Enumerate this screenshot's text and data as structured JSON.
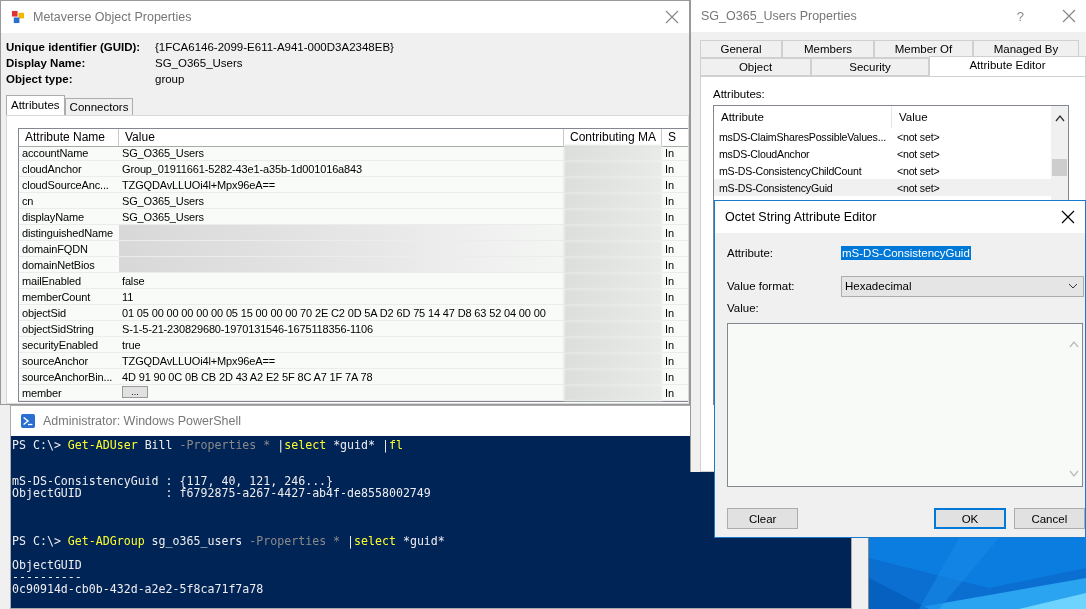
{
  "metaverse_window": {
    "title": "Metaverse Object Properties",
    "fields": [
      {
        "label": "Unique identifier (GUID):",
        "value": "{1FCA6146-2099-E611-A941-000D3A2348EB}"
      },
      {
        "label": "Display Name:",
        "value": "SG_O365_Users"
      },
      {
        "label": "Object type:",
        "value": "group"
      }
    ],
    "tabs": [
      {
        "label": "Attributes",
        "selected": true
      },
      {
        "label": "Connectors",
        "selected": false
      }
    ],
    "table": {
      "columns": [
        "Attribute Name",
        "Value",
        "Contributing MA",
        "S"
      ],
      "rows": [
        {
          "name": "accountName",
          "kind": "text",
          "value": "SG_O365_Users",
          "column_4": "In"
        },
        {
          "name": "cloudAnchor",
          "kind": "text",
          "value": "Group_01911661-5282-43e1-a35b-1d001016a843",
          "column_4": "In"
        },
        {
          "name": "cloudSourceAnc...",
          "kind": "text",
          "value": "TZGQDAvLLUOi4l+Mpx96eA==",
          "column_4": "In"
        },
        {
          "name": "cn",
          "kind": "text",
          "value": "SG_O365_Users",
          "column_4": "In"
        },
        {
          "name": "displayName",
          "kind": "text",
          "value": "SG_O365_Users",
          "column_4": "In"
        },
        {
          "name": "distinguishedName",
          "kind": "redacted",
          "column_4": "In"
        },
        {
          "name": "domainFQDN",
          "kind": "redacted",
          "column_4": "In"
        },
        {
          "name": "domainNetBios",
          "kind": "redacted",
          "column_4": "In"
        },
        {
          "name": "mailEnabled",
          "kind": "text",
          "value": "false",
          "column_4": "In"
        },
        {
          "name": "memberCount",
          "kind": "text",
          "value": "11",
          "column_4": "In"
        },
        {
          "name": "objectSid",
          "kind": "text",
          "value": "01 05 00 00 00 00 00 05 15 00 00 00 70 2E C2 0D 5A D2 6D 75 14 47 D8 63 52 04 00 00",
          "column_4": "In"
        },
        {
          "name": "objectSidString",
          "kind": "text",
          "value": "S-1-5-21-230829680-1970131546-1675118356-1106",
          "column_4": "In"
        },
        {
          "name": "securityEnabled",
          "kind": "text",
          "value": "true",
          "column_4": "In"
        },
        {
          "name": "sourceAnchor",
          "kind": "text",
          "value": "TZGQDAvLLUOi4l+Mpx96eA==",
          "column_4": "In"
        },
        {
          "name": "sourceAnchorBin...",
          "kind": "text",
          "value": "4D 91 90 0C 0B CB 2D 43 A2 E2 5F 8C A7 1F 7A 78",
          "column_4": "In"
        },
        {
          "name": "member",
          "kind": "button",
          "value": "...",
          "column_4": "In"
        }
      ]
    }
  },
  "powershell_window": {
    "title": "Administrator: Windows PowerShell",
    "lines": [
      {
        "kind": "line",
        "segments": [
          {
            "kind": "plain",
            "text": "PS C:\\> "
          },
          {
            "kind": "cmd",
            "text": "Get-ADUser"
          },
          {
            "kind": "plain",
            "text": " Bill "
          },
          {
            "kind": "param",
            "text": "-Properties * "
          },
          {
            "kind": "plain",
            "text": "|"
          },
          {
            "kind": "cmd",
            "text": "select"
          },
          {
            "kind": "plain",
            "text": " *guid* |"
          },
          {
            "kind": "cmd",
            "text": "fl"
          }
        ]
      },
      {
        "kind": "blank"
      },
      {
        "kind": "blank"
      },
      {
        "kind": "line",
        "segments": [
          {
            "kind": "plain",
            "text": "mS-DS-ConsistencyGuid : {117, 40, 121, 246...}"
          }
        ]
      },
      {
        "kind": "line",
        "segments": [
          {
            "kind": "plain",
            "text": "ObjectGUID            : f6792875-a267-4427-ab4f-de8558002749"
          }
        ]
      },
      {
        "kind": "blank"
      },
      {
        "kind": "blank"
      },
      {
        "kind": "blank"
      },
      {
        "kind": "line",
        "segments": [
          {
            "kind": "plain",
            "text": "PS C:\\> "
          },
          {
            "kind": "cmd",
            "text": "Get-ADGroup"
          },
          {
            "kind": "plain",
            "text": " sg_o365_users "
          },
          {
            "kind": "param",
            "text": "-Properties * "
          },
          {
            "kind": "plain",
            "text": "|"
          },
          {
            "kind": "cmd",
            "text": "select"
          },
          {
            "kind": "plain",
            "text": " *guid*"
          }
        ]
      },
      {
        "kind": "blank"
      },
      {
        "kind": "line",
        "segments": [
          {
            "kind": "plain",
            "text": "ObjectGUID"
          }
        ]
      },
      {
        "kind": "line",
        "segments": [
          {
            "kind": "plain",
            "text": "----------"
          }
        ]
      },
      {
        "kind": "line",
        "segments": [
          {
            "kind": "plain",
            "text": "0c90914d-cb0b-432d-a2e2-5f8ca71f7a78"
          }
        ]
      }
    ]
  },
  "properties_window": {
    "title": "SG_O365_Users Properties",
    "help_button": "?",
    "tab_rows": [
      [
        {
          "label": "General",
          "selected": false
        },
        {
          "label": "Members",
          "selected": false
        },
        {
          "label": "Member Of",
          "selected": false
        },
        {
          "label": "Managed By",
          "selected": false
        }
      ],
      [
        {
          "label": "Object",
          "selected": false
        },
        {
          "label": "Security",
          "selected": false
        },
        {
          "label": "Attribute Editor",
          "selected": true
        }
      ]
    ],
    "attributes_label": "Attributes:",
    "list": {
      "columns": [
        "Attribute",
        "Value"
      ],
      "rows": [
        {
          "attribute": "msDS-ClaimSharesPossibleValues...",
          "value": "<not set>",
          "selected": false
        },
        {
          "attribute": "msDS-CloudAnchor",
          "value": "<not set>",
          "selected": false
        },
        {
          "attribute": "mS-DS-ConsistencyChildCount",
          "value": "<not set>",
          "selected": false
        },
        {
          "attribute": "mS-DS-ConsistencyGuid",
          "value": "<not set>",
          "selected": true
        }
      ]
    }
  },
  "octet_editor": {
    "title": "Octet String Attribute Editor",
    "attribute_label": "Attribute:",
    "attribute_value": "mS-DS-ConsistencyGuid",
    "format_label": "Value format:",
    "format_value": "Hexadecimal",
    "value_label": "Value:",
    "buttons": [
      {
        "label": "Clear",
        "default": false
      },
      {
        "label": "OK",
        "default": true
      },
      {
        "label": "Cancel",
        "default": false
      }
    ]
  }
}
